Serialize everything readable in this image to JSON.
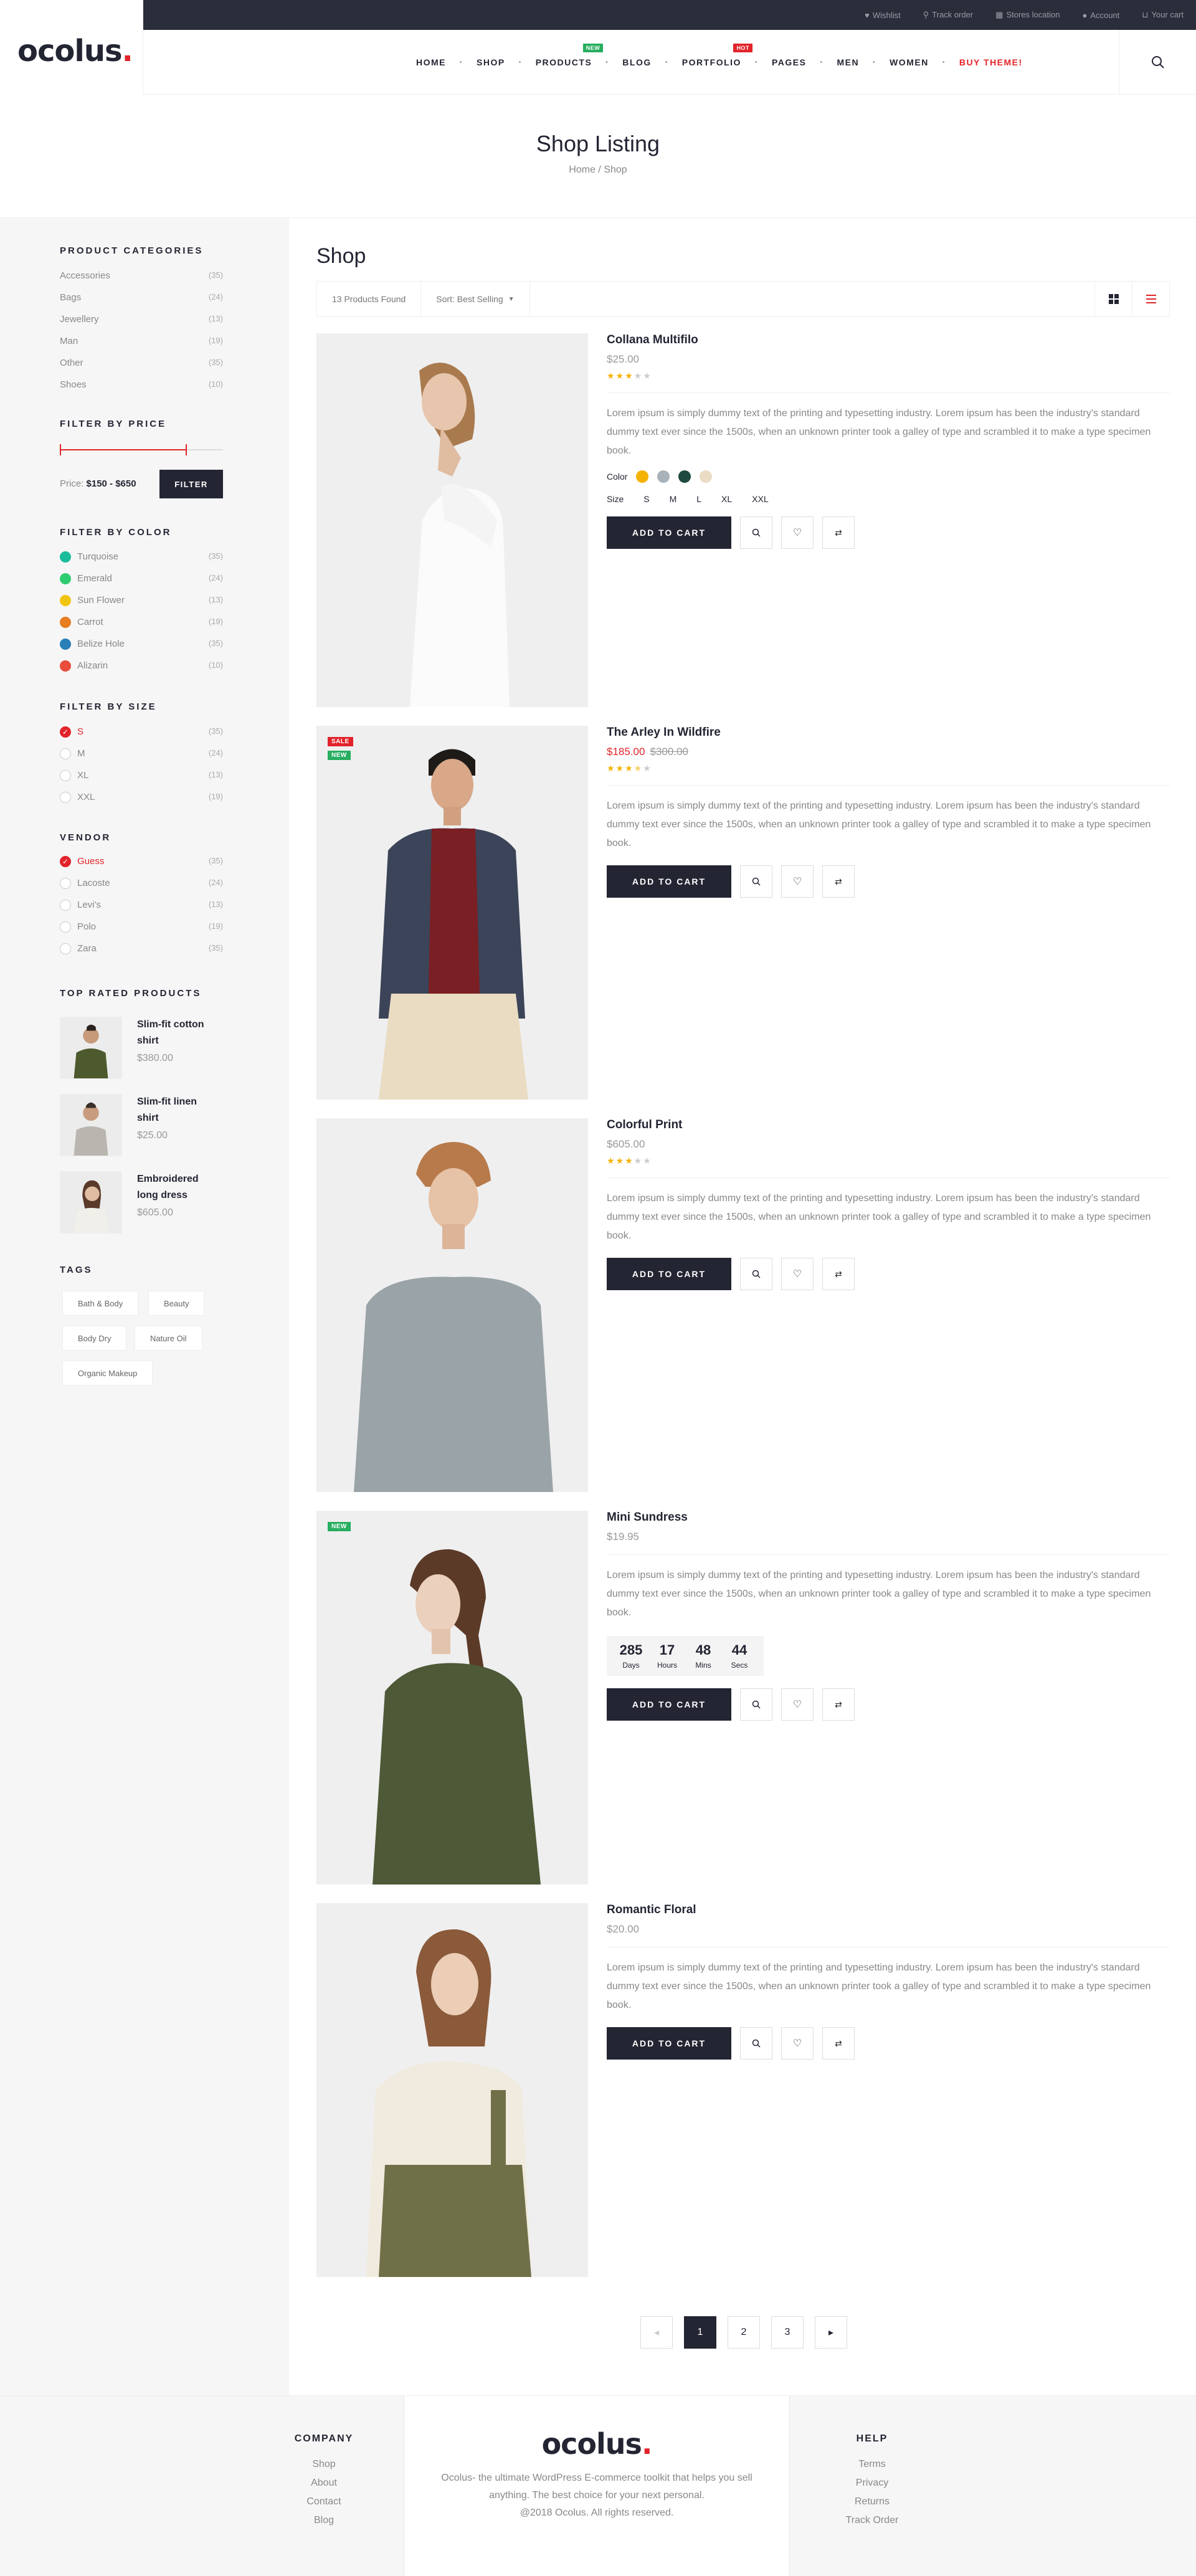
{
  "brand": {
    "name": "ocolus",
    "dot": "."
  },
  "topbar": {
    "links": [
      "Wishlist",
      "Track order",
      "Stores location",
      "Account",
      "Your cart"
    ]
  },
  "nav": {
    "items": [
      "HOME",
      "SHOP",
      "PRODUCTS",
      "BLOG",
      "PORTFOLIO",
      "PAGES",
      "MEN",
      "WOMEN",
      "BUY THEME!"
    ],
    "badges": {
      "products": "NEW",
      "portfolio": "HOT"
    },
    "colors": {
      "new": "#27ae60",
      "hot": "#e2232a"
    }
  },
  "page_header": {
    "title": "Shop Listing",
    "crumb_home": "Home",
    "crumb_sep": "/",
    "crumb_current": "Shop"
  },
  "sidebar": {
    "categories_title": "PRODUCT CATEGORIES",
    "categories": [
      {
        "name": "Accessories",
        "count": "(35)"
      },
      {
        "name": "Bags",
        "count": "(24)"
      },
      {
        "name": "Jewellery",
        "count": "(13)"
      },
      {
        "name": "Man",
        "count": "(19)"
      },
      {
        "name": "Other",
        "count": "(35)"
      },
      {
        "name": "Shoes",
        "count": "(10)"
      }
    ],
    "price_title": "FILTER BY PRICE",
    "price_label": "Price:",
    "price_range": "$150 - $650",
    "price_range_fraction": [
      0.0,
      0.78
    ],
    "filter_button": "FILTER",
    "color_title": "FILTER BY COLOR",
    "colors": [
      {
        "name": "Turquoise",
        "count": "(35)",
        "hex": "#1abc9c"
      },
      {
        "name": "Emerald",
        "count": "(24)",
        "hex": "#2ecc71"
      },
      {
        "name": "Sun Flower",
        "count": "(13)",
        "hex": "#f1c40f"
      },
      {
        "name": "Carrot",
        "count": "(19)",
        "hex": "#e67e22"
      },
      {
        "name": "Belize Hole",
        "count": "(35)",
        "hex": "#2980b9"
      },
      {
        "name": "Alizarin",
        "count": "(10)",
        "hex": "#e74c3c"
      }
    ],
    "size_title": "FILTER BY SIZE",
    "sizes": [
      {
        "name": "S",
        "count": "(35)",
        "checked": true
      },
      {
        "name": "M",
        "count": "(24)",
        "checked": false
      },
      {
        "name": "XL",
        "count": "(13)",
        "checked": false
      },
      {
        "name": "XXL",
        "count": "(19)",
        "checked": false
      }
    ],
    "vendor_title": "VENDOR",
    "vendors": [
      {
        "name": "Guess",
        "count": "(35)",
        "checked": true
      },
      {
        "name": "Lacoste",
        "count": "(24)",
        "checked": false
      },
      {
        "name": "Levi's",
        "count": "(13)",
        "checked": false
      },
      {
        "name": "Polo",
        "count": "(19)",
        "checked": false
      },
      {
        "name": "Zara",
        "count": "(35)",
        "checked": false
      }
    ],
    "top_rated_title": "TOP RATED PRODUCTS",
    "top_rated": [
      {
        "name": "Slim-fit cotton shirt",
        "price": "$380.00"
      },
      {
        "name": "Slim-fit linen shirt",
        "price": "$25.00"
      },
      {
        "name": "Embroidered long dress",
        "price": "$605.00"
      }
    ],
    "tags_title": "TAGS",
    "tags": [
      "Bath & Body",
      "Beauty",
      "Body Dry",
      "Nature Oil",
      "Organic Makeup"
    ]
  },
  "main": {
    "title": "Shop",
    "products_found": "13 Products Found",
    "sort_label": "Sort: Best Selling",
    "color_label": "Color",
    "size_label": "Size",
    "add_to_cart": "ADD TO CART",
    "description": "Lorem ipsum is simply dummy text of the printing and typesetting industry. Lorem ipsum has been the industry's standard dummy text ever since the 1500s, when an unknown printer took a galley of type and scrambled it to make a type specimen book.",
    "sizes": [
      "S",
      "M",
      "L",
      "XL",
      "XXL"
    ],
    "swatches": [
      "#f5b301",
      "#a9b2b8",
      "#1f4a3f",
      "#eadbc4"
    ],
    "products": [
      {
        "name": "Collana Multifilo",
        "price": "$25.00",
        "old_price": "",
        "rating": 3,
        "badges": []
      },
      {
        "name": "The Arley In Wildfire",
        "price": "$185.00",
        "old_price": "$300.00",
        "rating": 3.5,
        "badges": [
          "SALE",
          "NEW"
        ]
      },
      {
        "name": "Colorful Print",
        "price": "$605.00",
        "old_price": "",
        "rating": 3,
        "badges": []
      },
      {
        "name": "Mini Sundress",
        "price": "$19.95",
        "old_price": "",
        "rating": 0,
        "badges": [
          "NEW"
        ]
      },
      {
        "name": "Romantic Floral",
        "price": "$20.00",
        "old_price": "",
        "rating": 0,
        "badges": []
      }
    ],
    "countdown": [
      {
        "value": "285",
        "label": "Days"
      },
      {
        "value": "17",
        "label": "Hours"
      },
      {
        "value": "48",
        "label": "Mins"
      },
      {
        "value": "44",
        "label": "Secs"
      }
    ],
    "pagination": [
      "1",
      "2",
      "3"
    ]
  },
  "footer": {
    "company_title": "COMPANY",
    "company_links": [
      "Shop",
      "About",
      "Contact",
      "Blog"
    ],
    "about_text": "Ocolus- the ultimate WordPress E-commerce toolkit that helps you sell anything. The best choice for your next personal.",
    "copyright": "@2018 Ocolus. All rights reserved.",
    "help_title": "HELP",
    "help_links": [
      "Terms",
      "Privacy",
      "Returns",
      "Track Order"
    ]
  }
}
